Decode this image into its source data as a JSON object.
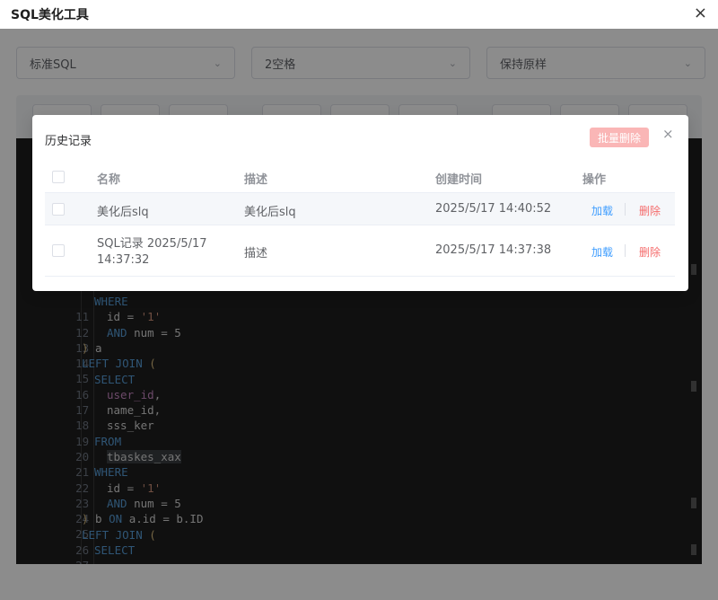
{
  "window": {
    "title": "SQL美化工具",
    "close_icon": "×"
  },
  "selects": [
    {
      "value": "标准SQL"
    },
    {
      "value": "2空格"
    },
    {
      "value": "保持原样"
    }
  ],
  "editor": {
    "lines": [
      {
        "n": "11"
      },
      {
        "n": "12"
      },
      {
        "n": "13"
      },
      {
        "n": "14"
      },
      {
        "n": "15"
      },
      {
        "n": "16"
      },
      {
        "n": "17"
      },
      {
        "n": "18"
      },
      {
        "n": "19"
      },
      {
        "n": "20"
      },
      {
        "n": "21"
      },
      {
        "n": "22"
      },
      {
        "n": "23"
      },
      {
        "n": "24"
      },
      {
        "n": "25"
      },
      {
        "n": "26"
      },
      {
        "n": "27"
      }
    ],
    "tokens": {
      "where": "WHERE",
      "id_eq": "id = ",
      "one": "'1'",
      "and": "AND",
      "num_eq": " num = 5",
      "close_a": ")",
      "a": " a",
      "left_join": "LEFT JOIN",
      "open": " (",
      "select": "SELECT",
      "user_id": "user_id",
      "comma": ",",
      "name_id": "name_id,",
      "sss_ker": "sss_ker",
      "from": "FROM",
      "tbaskes_xax": "tbaskes_xax",
      "close_b": ")",
      "b_on": " b ",
      "on": "ON",
      "on_expr": " a.id = b.ID"
    }
  },
  "dialog": {
    "title": "历史记录",
    "batch_delete": "批量删除",
    "close_icon": "×",
    "columns": {
      "name": "名称",
      "desc": "描述",
      "created": "创建时间",
      "actions": "操作"
    },
    "rows": [
      {
        "name": "美化后slq",
        "desc": "美化后slq",
        "created": "2025/5/17 14:40:52",
        "load": "加载",
        "delete": "删除"
      },
      {
        "name_line1": "SQL记录 2025/5/17",
        "name_line2": "14:37:32",
        "desc": "描述",
        "created": "2025/5/17 14:37:38",
        "load": "加载",
        "delete": "删除"
      }
    ]
  }
}
